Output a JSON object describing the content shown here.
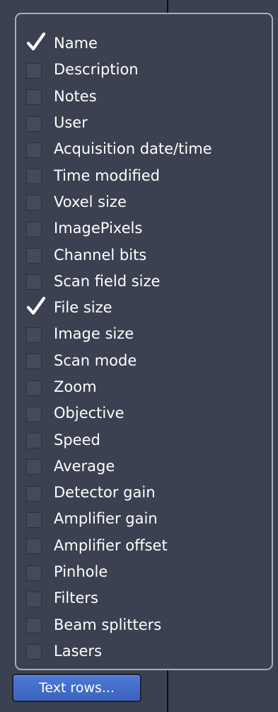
{
  "columns_panel": {
    "items": [
      {
        "label": "Name",
        "checked": true
      },
      {
        "label": "Description",
        "checked": false
      },
      {
        "label": "Notes",
        "checked": false
      },
      {
        "label": "User",
        "checked": false
      },
      {
        "label": "Acquisition date/time",
        "checked": false
      },
      {
        "label": "Time modified",
        "checked": false
      },
      {
        "label": "Voxel size",
        "checked": false
      },
      {
        "label": "ImagePixels",
        "checked": false
      },
      {
        "label": "Channel bits",
        "checked": false
      },
      {
        "label": "Scan field size",
        "checked": false
      },
      {
        "label": "File size",
        "checked": true
      },
      {
        "label": "Image size",
        "checked": false
      },
      {
        "label": "Scan mode",
        "checked": false
      },
      {
        "label": "Zoom",
        "checked": false
      },
      {
        "label": "Objective",
        "checked": false
      },
      {
        "label": "Speed",
        "checked": false
      },
      {
        "label": "Average",
        "checked": false
      },
      {
        "label": "Detector gain",
        "checked": false
      },
      {
        "label": "Amplifier gain",
        "checked": false
      },
      {
        "label": "Amplifier offset",
        "checked": false
      },
      {
        "label": "Pinhole",
        "checked": false
      },
      {
        "label": "Filters",
        "checked": false
      },
      {
        "label": "Beam splitters",
        "checked": false
      },
      {
        "label": "Lasers",
        "checked": false
      }
    ]
  },
  "footer": {
    "text_rows_button_label": "Text rows..."
  },
  "colors": {
    "background": "#3b4150",
    "panel_border": "#a8aeb9",
    "checkbox_fill": "#444a59",
    "checkmark": "#ffffff",
    "button_fill": "#4a73cf",
    "text": "#ffffff"
  },
  "icons": {
    "checked": "checkmark-icon"
  }
}
